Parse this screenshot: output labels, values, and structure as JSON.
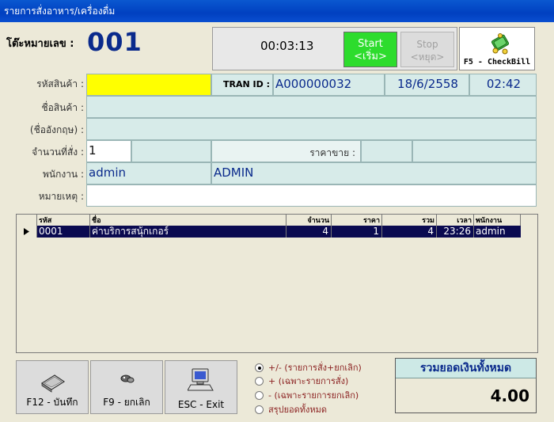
{
  "window": {
    "title": "รายการสั่งอาหาร/เครื่องดื่ม"
  },
  "table": {
    "label": "โต๊ะหมายเลข :",
    "number": "001"
  },
  "timer": {
    "elapsed": "00:03:13",
    "start_label_1": "Start",
    "start_label_2": "<เริ่ม>",
    "stop_label_1": "Stop",
    "stop_label_2": "<หยุด>"
  },
  "checkbill": {
    "label": "F5 - CheckBill",
    "icon": "money-stack-icon"
  },
  "form": {
    "product_code_label": "รหัสสินค้า :",
    "product_code_value": "",
    "tran_id_label": "TRAN ID :",
    "tran_id_value": "A000000032",
    "date": "18/6/2558",
    "time": "02:42",
    "product_name_label": "ชื่อสินค้า :",
    "product_name_value": "",
    "english_name_label": "(ชื่ออังกฤษ) :",
    "english_name_value": "",
    "qty_label": "จำนวนที่สั่ง :",
    "qty_value": "1",
    "price_label": "ราคาขาย :",
    "price_value": "",
    "staff_label": "พนักงาน :",
    "staff_value": "admin",
    "staff_name": "ADMIN",
    "note_label": "หมายเหตุ :",
    "note_value": ""
  },
  "grid": {
    "columns": [
      "รหัส",
      "ชื่อ",
      "จำนวน",
      "ราคา",
      "รวม",
      "เวลา",
      "พนักงาน"
    ],
    "rows": [
      {
        "code": "0001",
        "name": "ค่าบริการสนุ้กเกอร์",
        "qty": "4",
        "price": "1",
        "total": "4",
        "time": "23:26",
        "staff": "admin"
      }
    ]
  },
  "buttons": {
    "save": "F12 - บันทึก",
    "cancel": "F9 - ยกเลิก",
    "exit": "ESC - Exit"
  },
  "filter": {
    "options": [
      "+/- (รายการสั่ง+ยกเลิก)",
      "+ (เฉพาะรายการสั่ง)",
      "- (เฉพาะรายการยกเลิก)",
      "สรุปยอดทั้งหมด"
    ],
    "selected": "+/- (รายการสั่ง+ยกเลิก)"
  },
  "total": {
    "label": "รวมยอดเงินทั้งหมด",
    "value": "4.00"
  },
  "colors": {
    "titlebar": "#0a58d0",
    "start": "#2ddc2d",
    "field": "#d7ebe9",
    "highlight": "#ffff00",
    "row_selected": "#0a0a50"
  }
}
